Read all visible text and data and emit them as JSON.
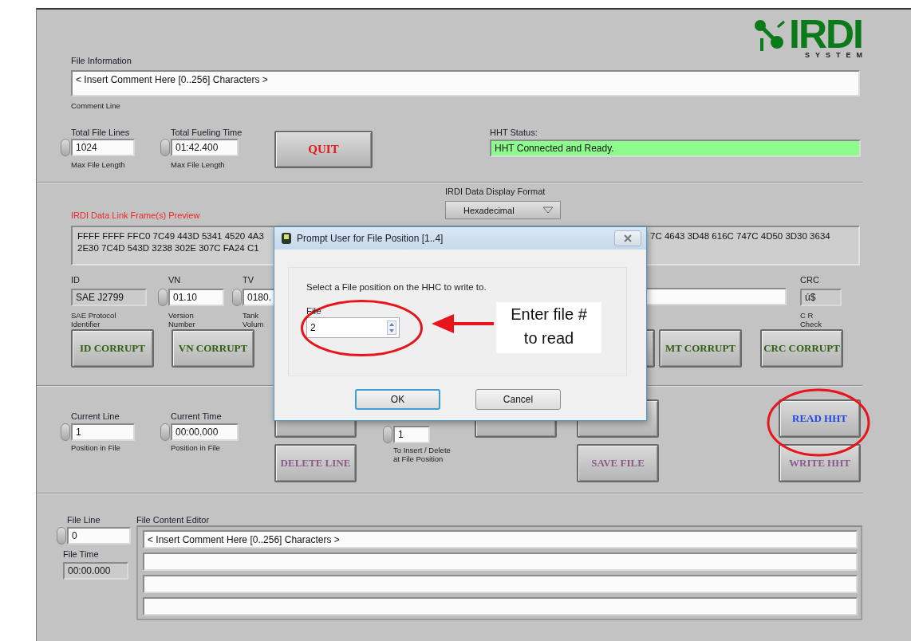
{
  "logo": {
    "text": "IRDI",
    "subtitle": "SYSTEM"
  },
  "file_information": {
    "label": "File Information",
    "value": "< Insert Comment Here [0..256] Characters >",
    "caption": "Comment Line"
  },
  "total_file_lines": {
    "label": "Total File Lines",
    "value": "1024",
    "caption": "Max File Length"
  },
  "total_fueling_time": {
    "label": "Total Fueling Time",
    "value": "01:42.400",
    "caption": "Max File Length"
  },
  "quit_button": "QUIT",
  "hht_status": {
    "label": "HHT Status:",
    "value": "HHT Connected and Ready."
  },
  "display_format": {
    "label": "IRDI Data Display Format",
    "value": "Hexadecimal"
  },
  "preview": {
    "label": "IRDI Data Link Frame(s) Preview",
    "line_1_left": "FFFF FFFF FFC0 7C49 443D 5341 4520 4A3",
    "line_1_right": "7C 4643 3D48 616C 747C 4D50 3D30 3634",
    "line_2_left": "2E30 7C4D 543D 3238 302E 307C FA24 C1"
  },
  "frame_fields": [
    {
      "label": "ID",
      "value": "SAE J2799",
      "caption": "SAE Protocol\nIdentifier",
      "kind": "indicator"
    },
    {
      "label": "VN",
      "value": "01.10",
      "caption": "Version\nNumber",
      "kind": "spinner"
    },
    {
      "label": "TV",
      "value": "0180.",
      "caption": "Tank\nVolum",
      "kind": "spinner"
    }
  ],
  "crc_field": {
    "label": "CRC",
    "value": "ú$",
    "caption": "C R\nCheck"
  },
  "corrupt_buttons_left": [
    "ID CORRUPT",
    "VN CORRUPT"
  ],
  "corrupt_buttons_right": [
    "MT CORRUPT",
    "CRC CORRUPT"
  ],
  "current_line": {
    "label": "Current Line",
    "value": "1",
    "caption": "Position in File"
  },
  "current_time": {
    "label": "Current Time",
    "value": "00:00.000",
    "caption": "Position in File"
  },
  "delete_line_button": "DELETE LINE",
  "insert_position": {
    "value": "1",
    "caption": "To Insert / Delete\nat File Position"
  },
  "save_file_button": "SAVE FILE",
  "read_hht_button": "READ HHT",
  "write_hht_button": "WRITE HHT",
  "file_line": {
    "label": "File Line",
    "value": "0"
  },
  "file_time": {
    "label": "File Time",
    "value": "00:00.000"
  },
  "editor": {
    "label": "File Content Editor",
    "lines": [
      "< Insert Comment Here [0..256] Characters >"
    ]
  },
  "dialog": {
    "title": "Prompt User for File Position [1..4]",
    "message": "Select a File position on the HHC to write to.",
    "field_label": "File",
    "value": "2",
    "buttons": [
      {
        "label": "OK",
        "default": true
      },
      {
        "label": "Cancel",
        "default": false
      }
    ]
  },
  "callout": "Enter file #\nto read"
}
